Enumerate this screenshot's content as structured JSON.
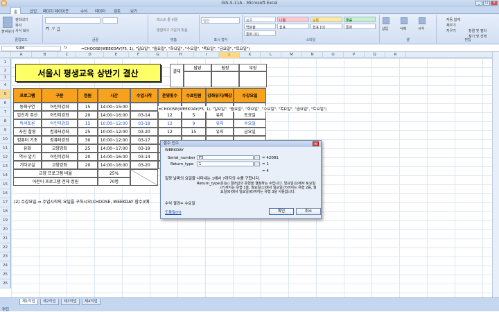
{
  "window": {
    "title": "GIS-S-11A - Microsoft Excel"
  },
  "tabs": [
    "홈",
    "삽입",
    "페이지 레이아웃",
    "수식",
    "데이터",
    "검토",
    "보기"
  ],
  "ribbon": {
    "paste": "붙여넣기",
    "cut": "잘라내기",
    "copy": "복사",
    "format_painter": "서식 복사",
    "clipboard": "클립보드",
    "font": "글꼴",
    "align": "맞춤",
    "wrap": "텍스트 줄 바꿈",
    "merge": "병합하고 가운데 맞춤",
    "number": "표시 형식",
    "general": "일반",
    "styles": "스타일",
    "cell_insert": "삽입",
    "cell_delete": "삭제",
    "cell_format": "서식",
    "cells": "셀",
    "autosum": "자동 합계",
    "fill": "채우기",
    "clear": "지우기",
    "sort": "정렬 및 필터",
    "find": "찾기 및 선택",
    "editing": "편집",
    "style_names": [
      "표준",
      "나쁨",
      "보통",
      "좋음",
      "백분율",
      "쉼표",
      "쉼표 [0]",
      "통화",
      "통화 [0]"
    ]
  },
  "formula_bar": {
    "name_box": "SUM",
    "fx": "fx",
    "formula": "=CHOOSE(WEEKDAY(F5, 1), \"일요일\", \"월요일\", \"화요일\", \"수요일\", \"목요일\", \"금요일\", \"토요일\")"
  },
  "columns": [
    "A",
    "B",
    "C",
    "D",
    "E",
    "F",
    "G",
    "H",
    "I",
    "J",
    "K",
    "L",
    "M",
    "N",
    "O",
    "P",
    "Q",
    "R"
  ],
  "rows": [
    "1",
    "2",
    "3",
    "4",
    "5",
    "6",
    "7",
    "8",
    "9",
    "10",
    "11",
    "12",
    "13",
    "14",
    "15",
    "16",
    "17",
    "18",
    "19",
    "20",
    "21",
    "22",
    "23",
    "24",
    "25",
    "26"
  ],
  "sheet": {
    "title": "서울시 평생교육 상반기 결산",
    "approval": {
      "label": "결재",
      "roles": [
        "담당",
        "팀장",
        "부장"
      ]
    },
    "headers": [
      "프로그램",
      "구분",
      "정원",
      "시간",
      "수업시작",
      "운영횟수",
      "수료인원",
      "강좌유지/폐강",
      "수강요일"
    ],
    "rows": [
      [
        "동화구연",
        "어린이강좌",
        "15",
        "14:00~15:00",
        "",
        "",
        "",
        "",
        ""
      ],
      [
        "압신과 주산",
        "어린이강좌",
        "20",
        "14:00~16:00",
        "03-14",
        "12",
        "5",
        "유지",
        "토요일"
      ],
      [
        "독서토론",
        "어린이강좌",
        "15",
        "10:00~12:00",
        "03-18",
        "12",
        "9",
        "유지",
        "수요일"
      ],
      [
        "사진 촬영",
        "컴퓨터강좌",
        "25",
        "10:00~12:00",
        "03-20",
        "12",
        "15",
        "유지",
        "금요일"
      ],
      [
        "컴퓨터 기초",
        "컴퓨터강좌",
        "30",
        "10:00~12:00",
        "03-17",
        "",
        "",
        "",
        ""
      ],
      [
        "유화",
        "교양강좌",
        "25",
        "14:00~17:00",
        "03-19",
        "",
        "",
        "",
        ""
      ],
      [
        "역사 알기",
        "어린이강좌",
        "20",
        "14:00~16:00",
        "03-14",
        "",
        "",
        "",
        ""
      ],
      [
        "기타교실",
        "교양강좌",
        "20",
        "14:00~16:00",
        "03-20",
        "",
        "",
        "",
        ""
      ]
    ],
    "summary": [
      {
        "label": "교양 프로그램 비율",
        "value": "25%"
      },
      {
        "label": "어린이 프로그램 전체 정원",
        "value": "70명"
      }
    ],
    "editing_formula": "=CHOOSE(WEEKDAY(F5, 1), \"일요일\", \"월요일\", \"화요일\", \"수요일\", \"목요일\", \"금요일\", \"토요일\")",
    "note": "(2) 수강요일 ⇒ 수업시작의 요일을 구하시오(CHOOSE, WEEKDAY 함수)(예"
  },
  "dialog": {
    "title": "함수 인수",
    "function": "WEEKDAY",
    "arg1_label": "Serial_number",
    "arg1_value": "F5",
    "arg1_result": "= 42081",
    "arg2_label": "Return_type",
    "arg2_value": "1",
    "arg2_result": "= 1",
    "result": "= 4",
    "description": "일정 날짜의 요일을 나타내는 1에서 7까지의 수를 구합니다.",
    "help_arg": "Return_type",
    "help_text": "은(는) 결과값의 유형을 결정하는 수입니다. 일요일(1)에서 토요일(7)까지는 유형 1을, 월요일(1)에서 일요일(7)까지는 유형 2를, 월요일(0)에서 일요일(6)까지는 유형 3을 사용합니다.",
    "formula_result": "수식 결과= 수요일",
    "help_link": "도움말(H)",
    "ok": "확인",
    "cancel": "취소"
  },
  "sheet_tabs": [
    "제1작업",
    "제2작업",
    "제3작업",
    "제4작업"
  ],
  "status": "편집"
}
